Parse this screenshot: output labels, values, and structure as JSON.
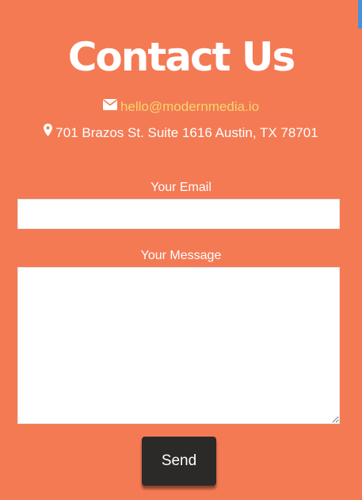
{
  "header": {
    "title": "Contact Us"
  },
  "contact_info": {
    "email": "hello@modernmedia.io",
    "email_icon": "envelope-icon",
    "address": "701 Brazos St. Suite 1616 Austin, TX 78701",
    "address_icon": "map-marker-icon"
  },
  "form": {
    "email_label": "Your Email",
    "email_value": "",
    "email_placeholder": "",
    "message_label": "Your Message",
    "message_value": "",
    "message_placeholder": "",
    "send_label": "Send"
  },
  "colors": {
    "background": "#f47a54",
    "link": "#f5d76e",
    "button": "#2b2a28",
    "text": "#ffffff"
  }
}
